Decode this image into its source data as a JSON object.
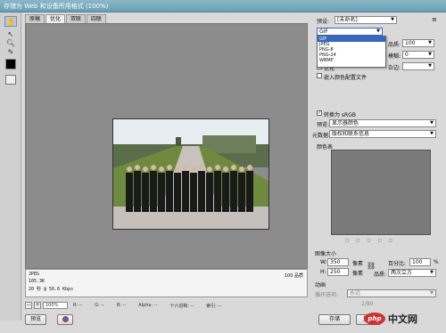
{
  "window": {
    "title": "存储为 Web 和设备所用格式 (100%)"
  },
  "tools": [
    "hand-icon",
    "slice-select-icon",
    "zoom-icon",
    "eyedropper-icon"
  ],
  "tabs": [
    "原稿",
    "优化",
    "双联",
    "四联"
  ],
  "active_tab": "优化",
  "info": {
    "format": "JPEG",
    "size": "105.3K",
    "time": "20 秒 @ 56.6 Kbps",
    "quality": "100 品质"
  },
  "status": {
    "zoom": "100%",
    "r": "R: --",
    "g": "G: --",
    "b": "B: --",
    "alpha": "Alpha: --",
    "hex": "十六进制: --",
    "index": "索引: --"
  },
  "buttons": {
    "preview": "预览",
    "save": "存储",
    "reset": "复位"
  },
  "settings": {
    "preset_label": "预设:",
    "preset_value": "[未命名]",
    "format_value": "GIF",
    "quality_label": "品质:",
    "quality_value": "100",
    "blur_label": "模糊:",
    "blur_value": "0",
    "matte_label": "杂边:",
    "optimized_label": "优化",
    "embed_profile_label": "嵌入颜色配置文件",
    "convert_srgb_label": "转换为 sRGB",
    "preview_label": "预览:",
    "preview_value": "显示器颜色",
    "metadata_label": "元数据:",
    "metadata_value": "版权和联系信息",
    "color_table_label": "颜色表"
  },
  "format_options": [
    "GIF",
    "JPEG",
    "PNG-8",
    "PNG-24",
    "WBMP"
  ],
  "image_size": {
    "label": "图像大小",
    "w_label": "W:",
    "w_value": "350",
    "h_label": "H:",
    "h_value": "250",
    "unit": "像素",
    "percent_label": "百分比:",
    "percent_value": "100",
    "percent_unit": "%",
    "quality_label": "品质:",
    "quality_value": "两次立方"
  },
  "animation": {
    "label": "动画",
    "loop_label": "循环选项:",
    "loop_value": "永远",
    "frame_text": "2/80"
  },
  "watermark": {
    "logo": "php",
    "name": "中文网"
  },
  "colors": {
    "title_bar": "#7aabc0",
    "canvas": "#8c8c8c",
    "highlight": "#3269c4",
    "logo": "#cc3333"
  }
}
